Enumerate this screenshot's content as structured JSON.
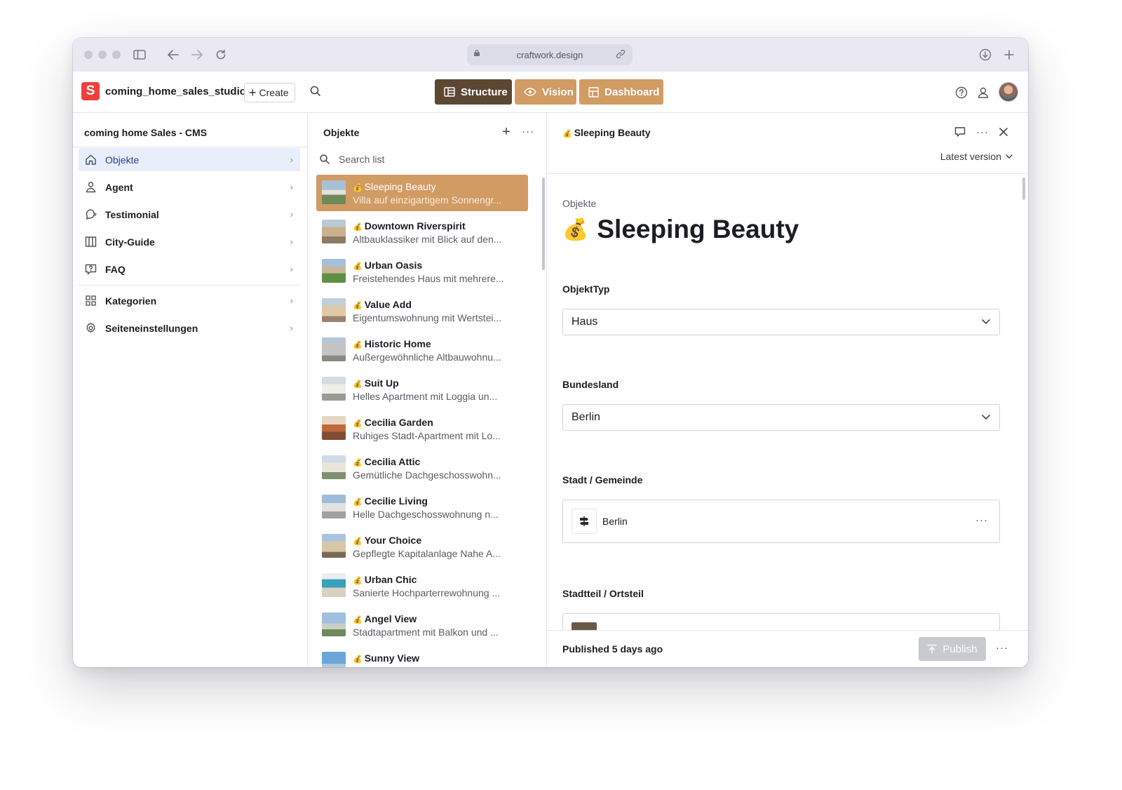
{
  "browser": {
    "url": "craftwork.design",
    "icons": [
      "sidebar-toggle-icon",
      "back-arrow-icon",
      "forward-arrow-icon",
      "reload-icon",
      "lock-icon",
      "link-icon",
      "download-icon",
      "new-tab-plus-icon"
    ]
  },
  "header": {
    "logo_letter": "S",
    "studio_name": "coming_home_sales_studio",
    "create_label": "Create",
    "tools": [
      {
        "label": "Structure",
        "active": true
      },
      {
        "label": "Vision",
        "active": false
      },
      {
        "label": "Dashboard",
        "active": false
      }
    ],
    "accent_color": "#d19b64",
    "active_tool_color": "#5c4733",
    "logo_color": "#f0403d"
  },
  "sidebar": {
    "title": "coming home Sales - CMS",
    "items": [
      {
        "label": "Objekte",
        "icon": "home-icon",
        "active": true
      },
      {
        "label": "Agent",
        "icon": "user-icon",
        "active": false
      },
      {
        "label": "Testimonial",
        "icon": "speech-bubble-icon",
        "active": false
      },
      {
        "label": "City-Guide",
        "icon": "book-icon",
        "active": false
      },
      {
        "label": "FAQ",
        "icon": "help-icon",
        "active": false
      },
      {
        "label": "Kategorien",
        "icon": "grid-icon",
        "active": false
      },
      {
        "label": "Seiteneinstellungen",
        "icon": "gear-icon",
        "active": false
      }
    ]
  },
  "list": {
    "title": "Objekte",
    "search_placeholder": "Search list",
    "items": [
      {
        "title": "Sleeping Beauty",
        "subtitle": "Villa auf einzigartigem Sonnengr...",
        "selected": true
      },
      {
        "title": "Downtown Riverspirit",
        "subtitle": "Altbauklassiker mit Blick auf den...",
        "selected": false
      },
      {
        "title": "Urban Oasis",
        "subtitle": "Freistehendes Haus mit mehrere...",
        "selected": false
      },
      {
        "title": "Value Add",
        "subtitle": "Eigentumswohnung mit Wertstei...",
        "selected": false
      },
      {
        "title": "Historic Home",
        "subtitle": "Außergewöhnliche Altbauwohnu...",
        "selected": false
      },
      {
        "title": "Suit Up",
        "subtitle": "Helles Apartment mit Loggia un...",
        "selected": false
      },
      {
        "title": "Cecilia Garden",
        "subtitle": "Ruhiges Stadt-Apartment mit Lo...",
        "selected": false
      },
      {
        "title": "Cecilia Attic",
        "subtitle": "Gemütliche Dachgeschosswohn...",
        "selected": false
      },
      {
        "title": "Cecilie Living",
        "subtitle": "Helle Dachgeschosswohnung n...",
        "selected": false
      },
      {
        "title": "Your Choice",
        "subtitle": "Gepflegte Kapitalanlage Nahe A...",
        "selected": false
      },
      {
        "title": "Urban Chic",
        "subtitle": "Sanierte Hochparterrewohnung ...",
        "selected": false
      },
      {
        "title": "Angel View",
        "subtitle": "Stadtapartment mit Balkon und ...",
        "selected": false
      },
      {
        "title": "Sunny View",
        "subtitle": "",
        "selected": false
      }
    ]
  },
  "document": {
    "header_title": "Sleeping Beauty",
    "version_label": "Latest version",
    "type_label": "Objekte",
    "title": "Sleeping Beauty",
    "title_emoji": "💰",
    "fields": {
      "objekttyp": {
        "label": "ObjektTyp",
        "value": "Haus"
      },
      "bundesland": {
        "label": "Bundesland",
        "value": "Berlin"
      },
      "stadt": {
        "label": "Stadt / Gemeinde",
        "value": "Berlin"
      },
      "stadtteil": {
        "label": "Stadtteil / Ortsteil"
      }
    },
    "status": "Published 5 days ago",
    "publish_label": "Publish"
  }
}
